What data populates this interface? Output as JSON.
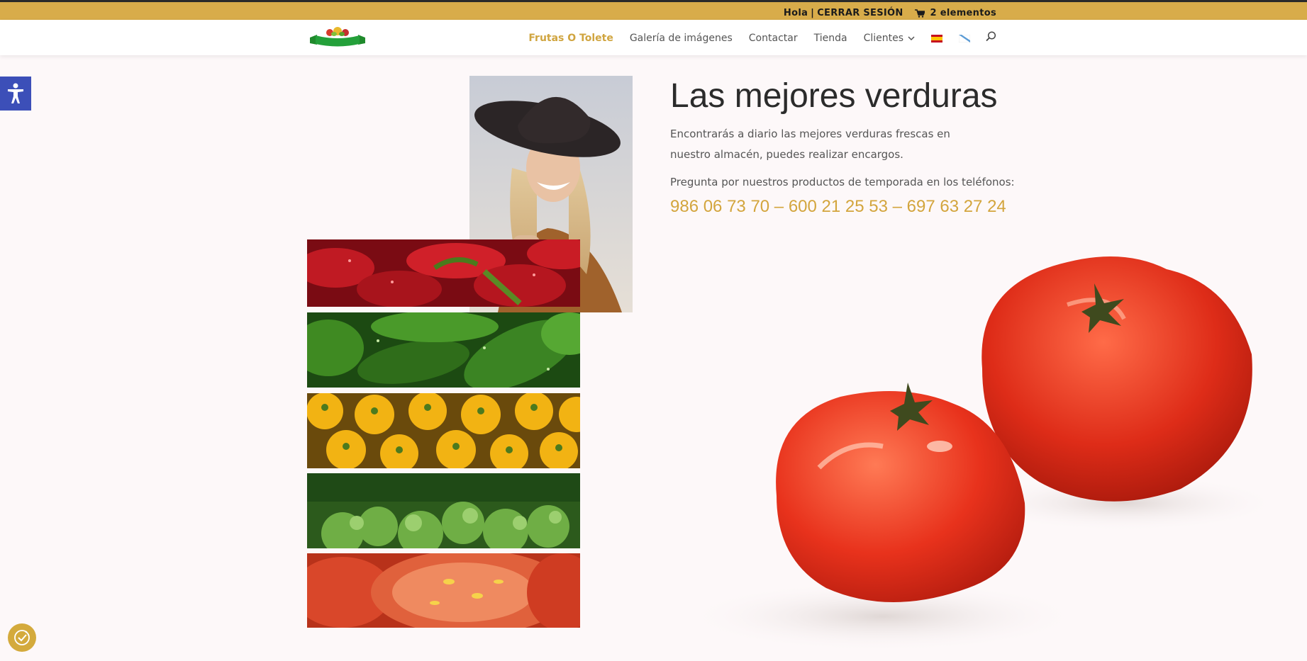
{
  "topbar": {
    "greeting": "Hola",
    "separator": "|",
    "logout": "CERRAR SESIÓN",
    "cart": "2 elementos"
  },
  "header": {
    "logo_text": "Frutas O Tolete",
    "nav": {
      "home": "Frutas O Tolete",
      "gallery": "Galería de imágenes",
      "contact": "Contactar",
      "shop": "Tienda",
      "clients": "Clientes"
    }
  },
  "hero": {
    "title": "Las mejores verduras",
    "paragraph1": "Encontrarás a diario las mejores verduras frescas en nuestro almacén, puedes realizar encargos.",
    "paragraph2": "Pregunta por nuestros productos de temporada en los teléfonos:",
    "phones": "986 06 73 70 – 600 21 25 53 – 697 63 27 24"
  },
  "colors": {
    "accent": "#d8ac4a",
    "accessibility": "#3c4fb8",
    "link_active": "#d0a540"
  },
  "icons": {
    "cart": "cart-icon",
    "search": "search-icon",
    "accessibility": "accessibility-icon",
    "cookie": "cookie-icon",
    "dropdown": "chevron-down-icon"
  }
}
